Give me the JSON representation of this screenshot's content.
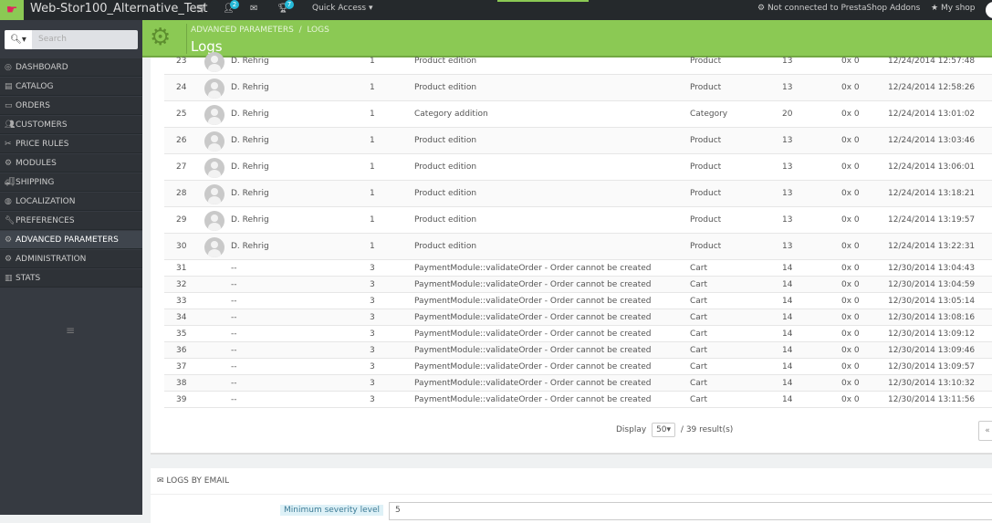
{
  "topbar": {
    "shop_name": "Web-Stor100_Alternative_Test",
    "customers_badge": "2",
    "trophy_badge": "7",
    "quick_access": "Quick Access",
    "addons_status": "Not connected to PrestaShop Addons",
    "my_shop": "My shop"
  },
  "search": {
    "placeholder": "Search"
  },
  "sidebar": {
    "items": [
      "DASHBOARD",
      "CATALOG",
      "ORDERS",
      "CUSTOMERS",
      "PRICE RULES",
      "MODULES",
      "SHIPPING",
      "LOCALIZATION",
      "PREFERENCES",
      "ADVANCED PARAMETERS",
      "ADMINISTRATION",
      "STATS"
    ],
    "active": "ADVANCED PARAMETERS"
  },
  "header": {
    "breadcrumb": [
      "ADVANCED PARAMETERS",
      "LOGS"
    ],
    "separator": "/",
    "title": "Logs"
  },
  "logs": [
    {
      "id": "23",
      "employee": "D. Rehrig",
      "severity": "1",
      "message": "Product edition",
      "object_type": "Product",
      "object_id": "13",
      "error_code": "0x 0",
      "date": "12/24/2014 12:57:48"
    },
    {
      "id": "24",
      "employee": "D. Rehrig",
      "severity": "1",
      "message": "Product edition",
      "object_type": "Product",
      "object_id": "13",
      "error_code": "0x 0",
      "date": "12/24/2014 12:58:26"
    },
    {
      "id": "25",
      "employee": "D. Rehrig",
      "severity": "1",
      "message": "Category addition",
      "object_type": "Category",
      "object_id": "20",
      "error_code": "0x 0",
      "date": "12/24/2014 13:01:02"
    },
    {
      "id": "26",
      "employee": "D. Rehrig",
      "severity": "1",
      "message": "Product edition",
      "object_type": "Product",
      "object_id": "13",
      "error_code": "0x 0",
      "date": "12/24/2014 13:03:46"
    },
    {
      "id": "27",
      "employee": "D. Rehrig",
      "severity": "1",
      "message": "Product edition",
      "object_type": "Product",
      "object_id": "13",
      "error_code": "0x 0",
      "date": "12/24/2014 13:06:01"
    },
    {
      "id": "28",
      "employee": "D. Rehrig",
      "severity": "1",
      "message": "Product edition",
      "object_type": "Product",
      "object_id": "13",
      "error_code": "0x 0",
      "date": "12/24/2014 13:18:21"
    },
    {
      "id": "29",
      "employee": "D. Rehrig",
      "severity": "1",
      "message": "Product edition",
      "object_type": "Product",
      "object_id": "13",
      "error_code": "0x 0",
      "date": "12/24/2014 13:19:57"
    },
    {
      "id": "30",
      "employee": "D. Rehrig",
      "severity": "1",
      "message": "Product edition",
      "object_type": "Product",
      "object_id": "13",
      "error_code": "0x 0",
      "date": "12/24/2014 13:22:31"
    },
    {
      "id": "31",
      "employee": "--",
      "severity": "3",
      "message": "PaymentModule::validateOrder - Order cannot be created",
      "object_type": "Cart",
      "object_id": "14",
      "error_code": "0x 0",
      "date": "12/30/2014 13:04:43"
    },
    {
      "id": "32",
      "employee": "--",
      "severity": "3",
      "message": "PaymentModule::validateOrder - Order cannot be created",
      "object_type": "Cart",
      "object_id": "14",
      "error_code": "0x 0",
      "date": "12/30/2014 13:04:59"
    },
    {
      "id": "33",
      "employee": "--",
      "severity": "3",
      "message": "PaymentModule::validateOrder - Order cannot be created",
      "object_type": "Cart",
      "object_id": "14",
      "error_code": "0x 0",
      "date": "12/30/2014 13:05:14"
    },
    {
      "id": "34",
      "employee": "--",
      "severity": "3",
      "message": "PaymentModule::validateOrder - Order cannot be created",
      "object_type": "Cart",
      "object_id": "14",
      "error_code": "0x 0",
      "date": "12/30/2014 13:08:16"
    },
    {
      "id": "35",
      "employee": "--",
      "severity": "3",
      "message": "PaymentModule::validateOrder - Order cannot be created",
      "object_type": "Cart",
      "object_id": "14",
      "error_code": "0x 0",
      "date": "12/30/2014 13:09:12"
    },
    {
      "id": "36",
      "employee": "--",
      "severity": "3",
      "message": "PaymentModule::validateOrder - Order cannot be created",
      "object_type": "Cart",
      "object_id": "14",
      "error_code": "0x 0",
      "date": "12/30/2014 13:09:46"
    },
    {
      "id": "37",
      "employee": "--",
      "severity": "3",
      "message": "PaymentModule::validateOrder - Order cannot be created",
      "object_type": "Cart",
      "object_id": "14",
      "error_code": "0x 0",
      "date": "12/30/2014 13:09:57"
    },
    {
      "id": "38",
      "employee": "--",
      "severity": "3",
      "message": "PaymentModule::validateOrder - Order cannot be created",
      "object_type": "Cart",
      "object_id": "14",
      "error_code": "0x 0",
      "date": "12/30/2014 13:10:32"
    },
    {
      "id": "39",
      "employee": "--",
      "severity": "3",
      "message": "PaymentModule::validateOrder - Order cannot be created",
      "object_type": "Cart",
      "object_id": "14",
      "error_code": "0x 0",
      "date": "12/30/2014 13:11:56"
    }
  ],
  "pagination": {
    "display_label": "Display",
    "per_page": "50",
    "results": "/ 39 result(s)",
    "prev": "«"
  },
  "logs_by_email": {
    "title": "LOGS BY EMAIL",
    "severity_label": "Minimum severity level",
    "severity_value": "5"
  },
  "colors": {
    "accent": "#8bc954",
    "topbar": "#25292c",
    "sidebar": "#363a41",
    "badge": "#25b9d7"
  }
}
